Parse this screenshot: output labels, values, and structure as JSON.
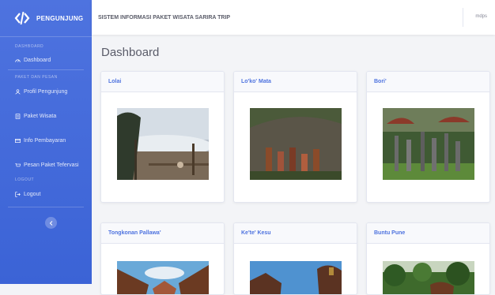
{
  "sidebar": {
    "brand": "PENGUNJUNG",
    "heading_dashboard": "DASHBOARD",
    "dashboard": "Dashboard",
    "heading_paket": "PAKET DAN PESAN",
    "profil": "Profil Pengunjung",
    "paket": "Paket Wisata",
    "info": "Info Pembayaran",
    "pesan": "Pesan Paket Tefervasi",
    "heading_logout": "LOGOUT",
    "logout": "Logout"
  },
  "topbar": {
    "title": "SISTEM INFORMASI PAKET WISATA SARIRA TRIP",
    "user": "mdps"
  },
  "page_title": "Dashboard",
  "cards": [
    {
      "title": "Lolai"
    },
    {
      "title": "Lo'ko' Mata"
    },
    {
      "title": "Bori'"
    },
    {
      "title": "Tongkonan Pallawa'"
    },
    {
      "title": "Ke'te' Kesu"
    },
    {
      "title": "Buntu Pune"
    }
  ]
}
